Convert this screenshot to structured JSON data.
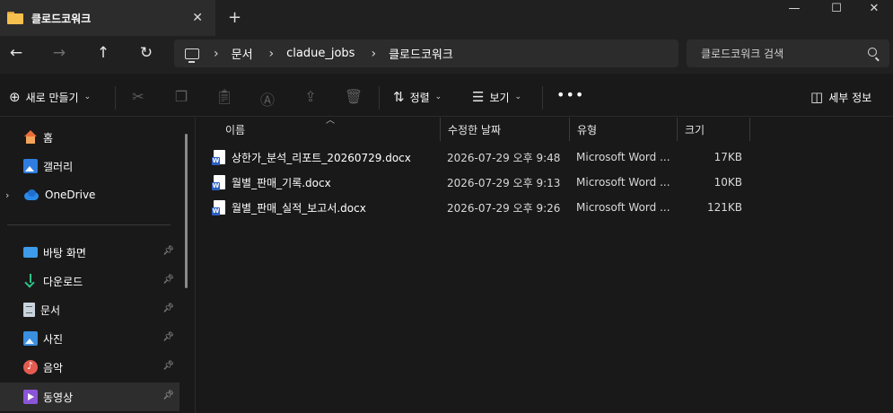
{
  "window": {
    "tab_title": "클로드코워크",
    "new_tab": "+",
    "controls": {
      "minimize": "—",
      "maximize": "☐",
      "close": "✕"
    }
  },
  "nav": {
    "back": "←",
    "forward": "→",
    "up": "↑",
    "refresh": "↻",
    "breadcrumbs": [
      "문서",
      "cladue_jobs",
      "클로드코워크"
    ],
    "search_placeholder": "클로드코워크 검색"
  },
  "commandbar": {
    "new_label": "새로 만들기",
    "sort_label": "정렬",
    "view_label": "보기",
    "details_label": "세부 정보",
    "more": "•••"
  },
  "sidebar": {
    "items": [
      {
        "label": "홈",
        "icon": "home-icon"
      },
      {
        "label": "갤러리",
        "icon": "gallery-icon"
      },
      {
        "label": "OneDrive",
        "icon": "onedrive-icon"
      },
      {
        "label": "바탕 화면",
        "icon": "desktop-icon"
      },
      {
        "label": "다운로드",
        "icon": "download-icon"
      },
      {
        "label": "문서",
        "icon": "documents-icon"
      },
      {
        "label": "사진",
        "icon": "pictures-icon"
      },
      {
        "label": "음악",
        "icon": "music-icon"
      },
      {
        "label": "동영상",
        "icon": "videos-icon"
      }
    ]
  },
  "table": {
    "columns": [
      "이름",
      "수정한 날짜",
      "유형",
      "크기"
    ],
    "rows": [
      {
        "name": "상한가_분석_리포트_20260729.docx",
        "date": "2026-07-29 오후 9:48",
        "type": "Microsoft Word ...",
        "size": "17KB"
      },
      {
        "name": "월별_판매_기록.docx",
        "date": "2026-07-29 오후 9:13",
        "type": "Microsoft Word ...",
        "size": "10KB"
      },
      {
        "name": "월별_판매_실적_보고서.docx",
        "date": "2026-07-29 오후 9:26",
        "type": "Microsoft Word ...",
        "size": "121KB"
      }
    ]
  },
  "colors": {
    "background": "#191919",
    "chrome": "#202020",
    "field": "#2c2c2c",
    "folder": "#f6c04f",
    "word_blue": "#2b5fbf"
  }
}
